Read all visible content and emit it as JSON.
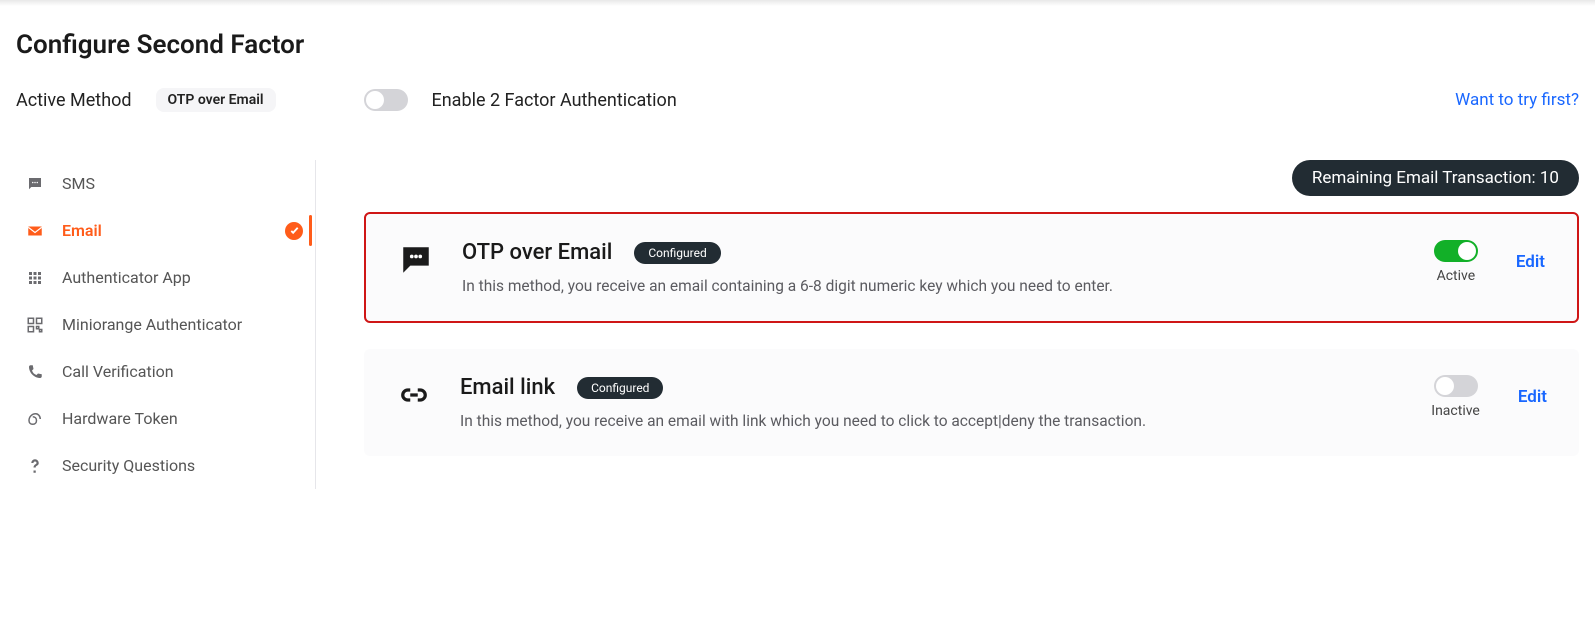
{
  "title": "Configure Second Factor",
  "active_method_label": "Active Method",
  "active_method_value": "OTP over Email",
  "enable_2fa_label": "Enable 2 Factor Authentication",
  "enable_2fa_on": false,
  "try_link": "Want to try first?",
  "sidebar": {
    "items": [
      {
        "icon": "sms-icon",
        "label": "SMS",
        "active": false,
        "checked": false
      },
      {
        "icon": "email-icon",
        "label": "Email",
        "active": true,
        "checked": true
      },
      {
        "icon": "auth-app-icon",
        "label": "Authenticator App",
        "active": false,
        "checked": false
      },
      {
        "icon": "miniorange-icon",
        "label": "Miniorange Authenticator",
        "active": false,
        "checked": false
      },
      {
        "icon": "call-icon",
        "label": "Call Verification",
        "active": false,
        "checked": false
      },
      {
        "icon": "hardware-icon",
        "label": "Hardware Token",
        "active": false,
        "checked": false
      },
      {
        "icon": "question-icon",
        "label": "Security Questions",
        "active": false,
        "checked": false
      }
    ]
  },
  "remaining_badge": "Remaining Email Transaction: 10",
  "methods": [
    {
      "icon": "speech-icon",
      "title": "OTP over Email",
      "badge": "Configured",
      "desc": "In this method, you receive an email containing a 6-8 digit numeric key which you need to enter.",
      "toggle_on": true,
      "toggle_label": "Active",
      "edit": "Edit",
      "highlight": true
    },
    {
      "icon": "link-icon",
      "title": "Email link",
      "badge": "Configured",
      "desc": "In this method, you receive an email with link which you need to click to accept|deny the transaction.",
      "toggle_on": false,
      "toggle_label": "Inactive",
      "edit": "Edit",
      "highlight": false
    }
  ]
}
